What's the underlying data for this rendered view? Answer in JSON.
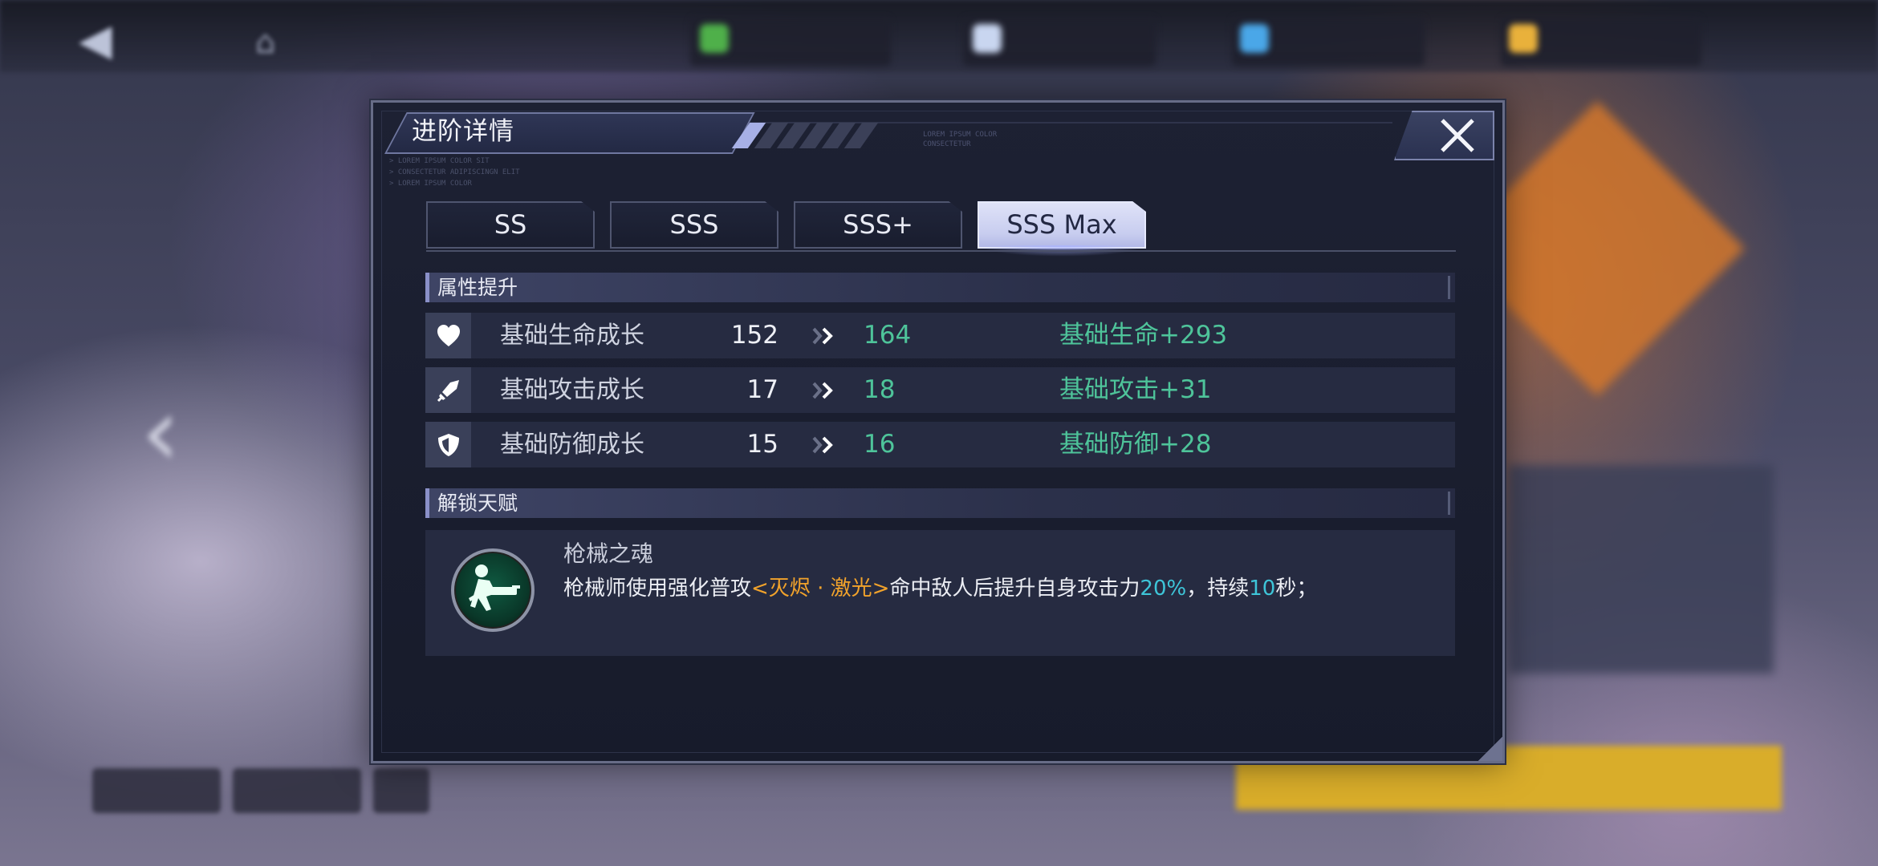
{
  "dialog": {
    "title": "进阶详情",
    "tabs": [
      {
        "label": "SS",
        "active": false
      },
      {
        "label": "SSS",
        "active": false
      },
      {
        "label": "SSS+",
        "active": false
      },
      {
        "label": "SSS Max",
        "active": true
      }
    ]
  },
  "attributes": {
    "header": "属性提升",
    "rows": [
      {
        "icon": "heart-icon",
        "name": "基础生命成长",
        "from": "152",
        "to": "164",
        "bonus": "基础生命+293"
      },
      {
        "icon": "sword-icon",
        "name": "基础攻击成长",
        "from": "17",
        "to": "18",
        "bonus": "基础攻击+31"
      },
      {
        "icon": "shield-icon",
        "name": "基础防御成长",
        "from": "15",
        "to": "16",
        "bonus": "基础防御+28"
      }
    ]
  },
  "talent": {
    "header": "解锁天赋",
    "name": "枪械之魂",
    "desc_1": "枪械师使用强化普攻",
    "desc_skill": "<灭烬 · 激光>",
    "desc_2": "命中敌人后提升自身攻击力",
    "desc_pct": "20%",
    "desc_3": "，持续",
    "desc_sec": "10",
    "desc_4": "秒；"
  },
  "colors": {
    "accent_green": "#4ec49a",
    "highlight_orange": "#f2a32b",
    "highlight_cyan": "#3ec5d8",
    "active_tab": "#d5d9f6"
  }
}
